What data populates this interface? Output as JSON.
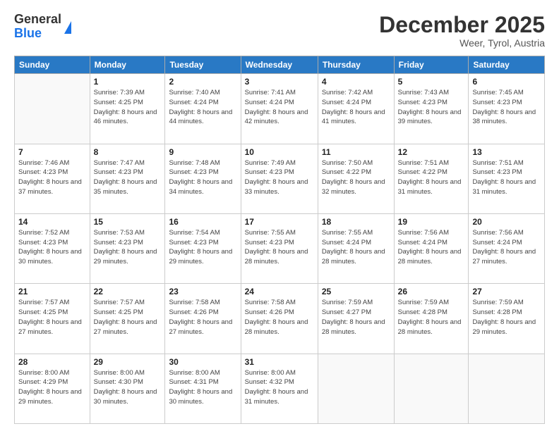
{
  "logo": {
    "general": "General",
    "blue": "Blue"
  },
  "header": {
    "month": "December 2025",
    "location": "Weer, Tyrol, Austria"
  },
  "weekdays": [
    "Sunday",
    "Monday",
    "Tuesday",
    "Wednesday",
    "Thursday",
    "Friday",
    "Saturday"
  ],
  "weeks": [
    [
      {
        "day": "",
        "empty": true
      },
      {
        "day": "1",
        "sunrise": "7:39 AM",
        "sunset": "4:25 PM",
        "daylight": "8 hours and 46 minutes."
      },
      {
        "day": "2",
        "sunrise": "7:40 AM",
        "sunset": "4:24 PM",
        "daylight": "8 hours and 44 minutes."
      },
      {
        "day": "3",
        "sunrise": "7:41 AM",
        "sunset": "4:24 PM",
        "daylight": "8 hours and 42 minutes."
      },
      {
        "day": "4",
        "sunrise": "7:42 AM",
        "sunset": "4:24 PM",
        "daylight": "8 hours and 41 minutes."
      },
      {
        "day": "5",
        "sunrise": "7:43 AM",
        "sunset": "4:23 PM",
        "daylight": "8 hours and 39 minutes."
      },
      {
        "day": "6",
        "sunrise": "7:45 AM",
        "sunset": "4:23 PM",
        "daylight": "8 hours and 38 minutes."
      }
    ],
    [
      {
        "day": "7",
        "sunrise": "7:46 AM",
        "sunset": "4:23 PM",
        "daylight": "8 hours and 37 minutes."
      },
      {
        "day": "8",
        "sunrise": "7:47 AM",
        "sunset": "4:23 PM",
        "daylight": "8 hours and 35 minutes."
      },
      {
        "day": "9",
        "sunrise": "7:48 AM",
        "sunset": "4:23 PM",
        "daylight": "8 hours and 34 minutes."
      },
      {
        "day": "10",
        "sunrise": "7:49 AM",
        "sunset": "4:23 PM",
        "daylight": "8 hours and 33 minutes."
      },
      {
        "day": "11",
        "sunrise": "7:50 AM",
        "sunset": "4:22 PM",
        "daylight": "8 hours and 32 minutes."
      },
      {
        "day": "12",
        "sunrise": "7:51 AM",
        "sunset": "4:22 PM",
        "daylight": "8 hours and 31 minutes."
      },
      {
        "day": "13",
        "sunrise": "7:51 AM",
        "sunset": "4:23 PM",
        "daylight": "8 hours and 31 minutes."
      }
    ],
    [
      {
        "day": "14",
        "sunrise": "7:52 AM",
        "sunset": "4:23 PM",
        "daylight": "8 hours and 30 minutes."
      },
      {
        "day": "15",
        "sunrise": "7:53 AM",
        "sunset": "4:23 PM",
        "daylight": "8 hours and 29 minutes."
      },
      {
        "day": "16",
        "sunrise": "7:54 AM",
        "sunset": "4:23 PM",
        "daylight": "8 hours and 29 minutes."
      },
      {
        "day": "17",
        "sunrise": "7:55 AM",
        "sunset": "4:23 PM",
        "daylight": "8 hours and 28 minutes."
      },
      {
        "day": "18",
        "sunrise": "7:55 AM",
        "sunset": "4:24 PM",
        "daylight": "8 hours and 28 minutes."
      },
      {
        "day": "19",
        "sunrise": "7:56 AM",
        "sunset": "4:24 PM",
        "daylight": "8 hours and 28 minutes."
      },
      {
        "day": "20",
        "sunrise": "7:56 AM",
        "sunset": "4:24 PM",
        "daylight": "8 hours and 27 minutes."
      }
    ],
    [
      {
        "day": "21",
        "sunrise": "7:57 AM",
        "sunset": "4:25 PM",
        "daylight": "8 hours and 27 minutes."
      },
      {
        "day": "22",
        "sunrise": "7:57 AM",
        "sunset": "4:25 PM",
        "daylight": "8 hours and 27 minutes."
      },
      {
        "day": "23",
        "sunrise": "7:58 AM",
        "sunset": "4:26 PM",
        "daylight": "8 hours and 27 minutes."
      },
      {
        "day": "24",
        "sunrise": "7:58 AM",
        "sunset": "4:26 PM",
        "daylight": "8 hours and 28 minutes."
      },
      {
        "day": "25",
        "sunrise": "7:59 AM",
        "sunset": "4:27 PM",
        "daylight": "8 hours and 28 minutes."
      },
      {
        "day": "26",
        "sunrise": "7:59 AM",
        "sunset": "4:28 PM",
        "daylight": "8 hours and 28 minutes."
      },
      {
        "day": "27",
        "sunrise": "7:59 AM",
        "sunset": "4:28 PM",
        "daylight": "8 hours and 29 minutes."
      }
    ],
    [
      {
        "day": "28",
        "sunrise": "8:00 AM",
        "sunset": "4:29 PM",
        "daylight": "8 hours and 29 minutes."
      },
      {
        "day": "29",
        "sunrise": "8:00 AM",
        "sunset": "4:30 PM",
        "daylight": "8 hours and 30 minutes."
      },
      {
        "day": "30",
        "sunrise": "8:00 AM",
        "sunset": "4:31 PM",
        "daylight": "8 hours and 30 minutes."
      },
      {
        "day": "31",
        "sunrise": "8:00 AM",
        "sunset": "4:32 PM",
        "daylight": "8 hours and 31 minutes."
      },
      {
        "day": "",
        "empty": true
      },
      {
        "day": "",
        "empty": true
      },
      {
        "day": "",
        "empty": true
      }
    ]
  ]
}
